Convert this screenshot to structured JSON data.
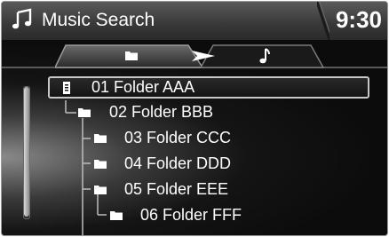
{
  "header": {
    "title": "Music Search",
    "clock": "9:30",
    "icon": "music-note-icon"
  },
  "tabs": [
    {
      "name": "folder",
      "icon": "folder-icon",
      "selected": true
    },
    {
      "name": "music",
      "icon": "music-note-icon",
      "selected": false
    }
  ],
  "list": {
    "items": [
      {
        "label": "01 Folder AAA",
        "icon": "file-icon",
        "selected": true
      },
      {
        "label": "02 Folder BBB",
        "icon": "folder-icon",
        "selected": false
      },
      {
        "label": "03 Folder CCC",
        "icon": "folder-icon",
        "selected": false
      },
      {
        "label": "04 Folder DDD",
        "icon": "folder-icon",
        "selected": false
      },
      {
        "label": "05 Folder EEE",
        "icon": "folder-icon",
        "selected": false
      },
      {
        "label": "06 Folder FFF",
        "icon": "folder-icon",
        "selected": false
      }
    ]
  },
  "colors": {
    "background": "#0c0c0c",
    "text": "#ffffff",
    "selection_border": "#c8c8c8"
  }
}
